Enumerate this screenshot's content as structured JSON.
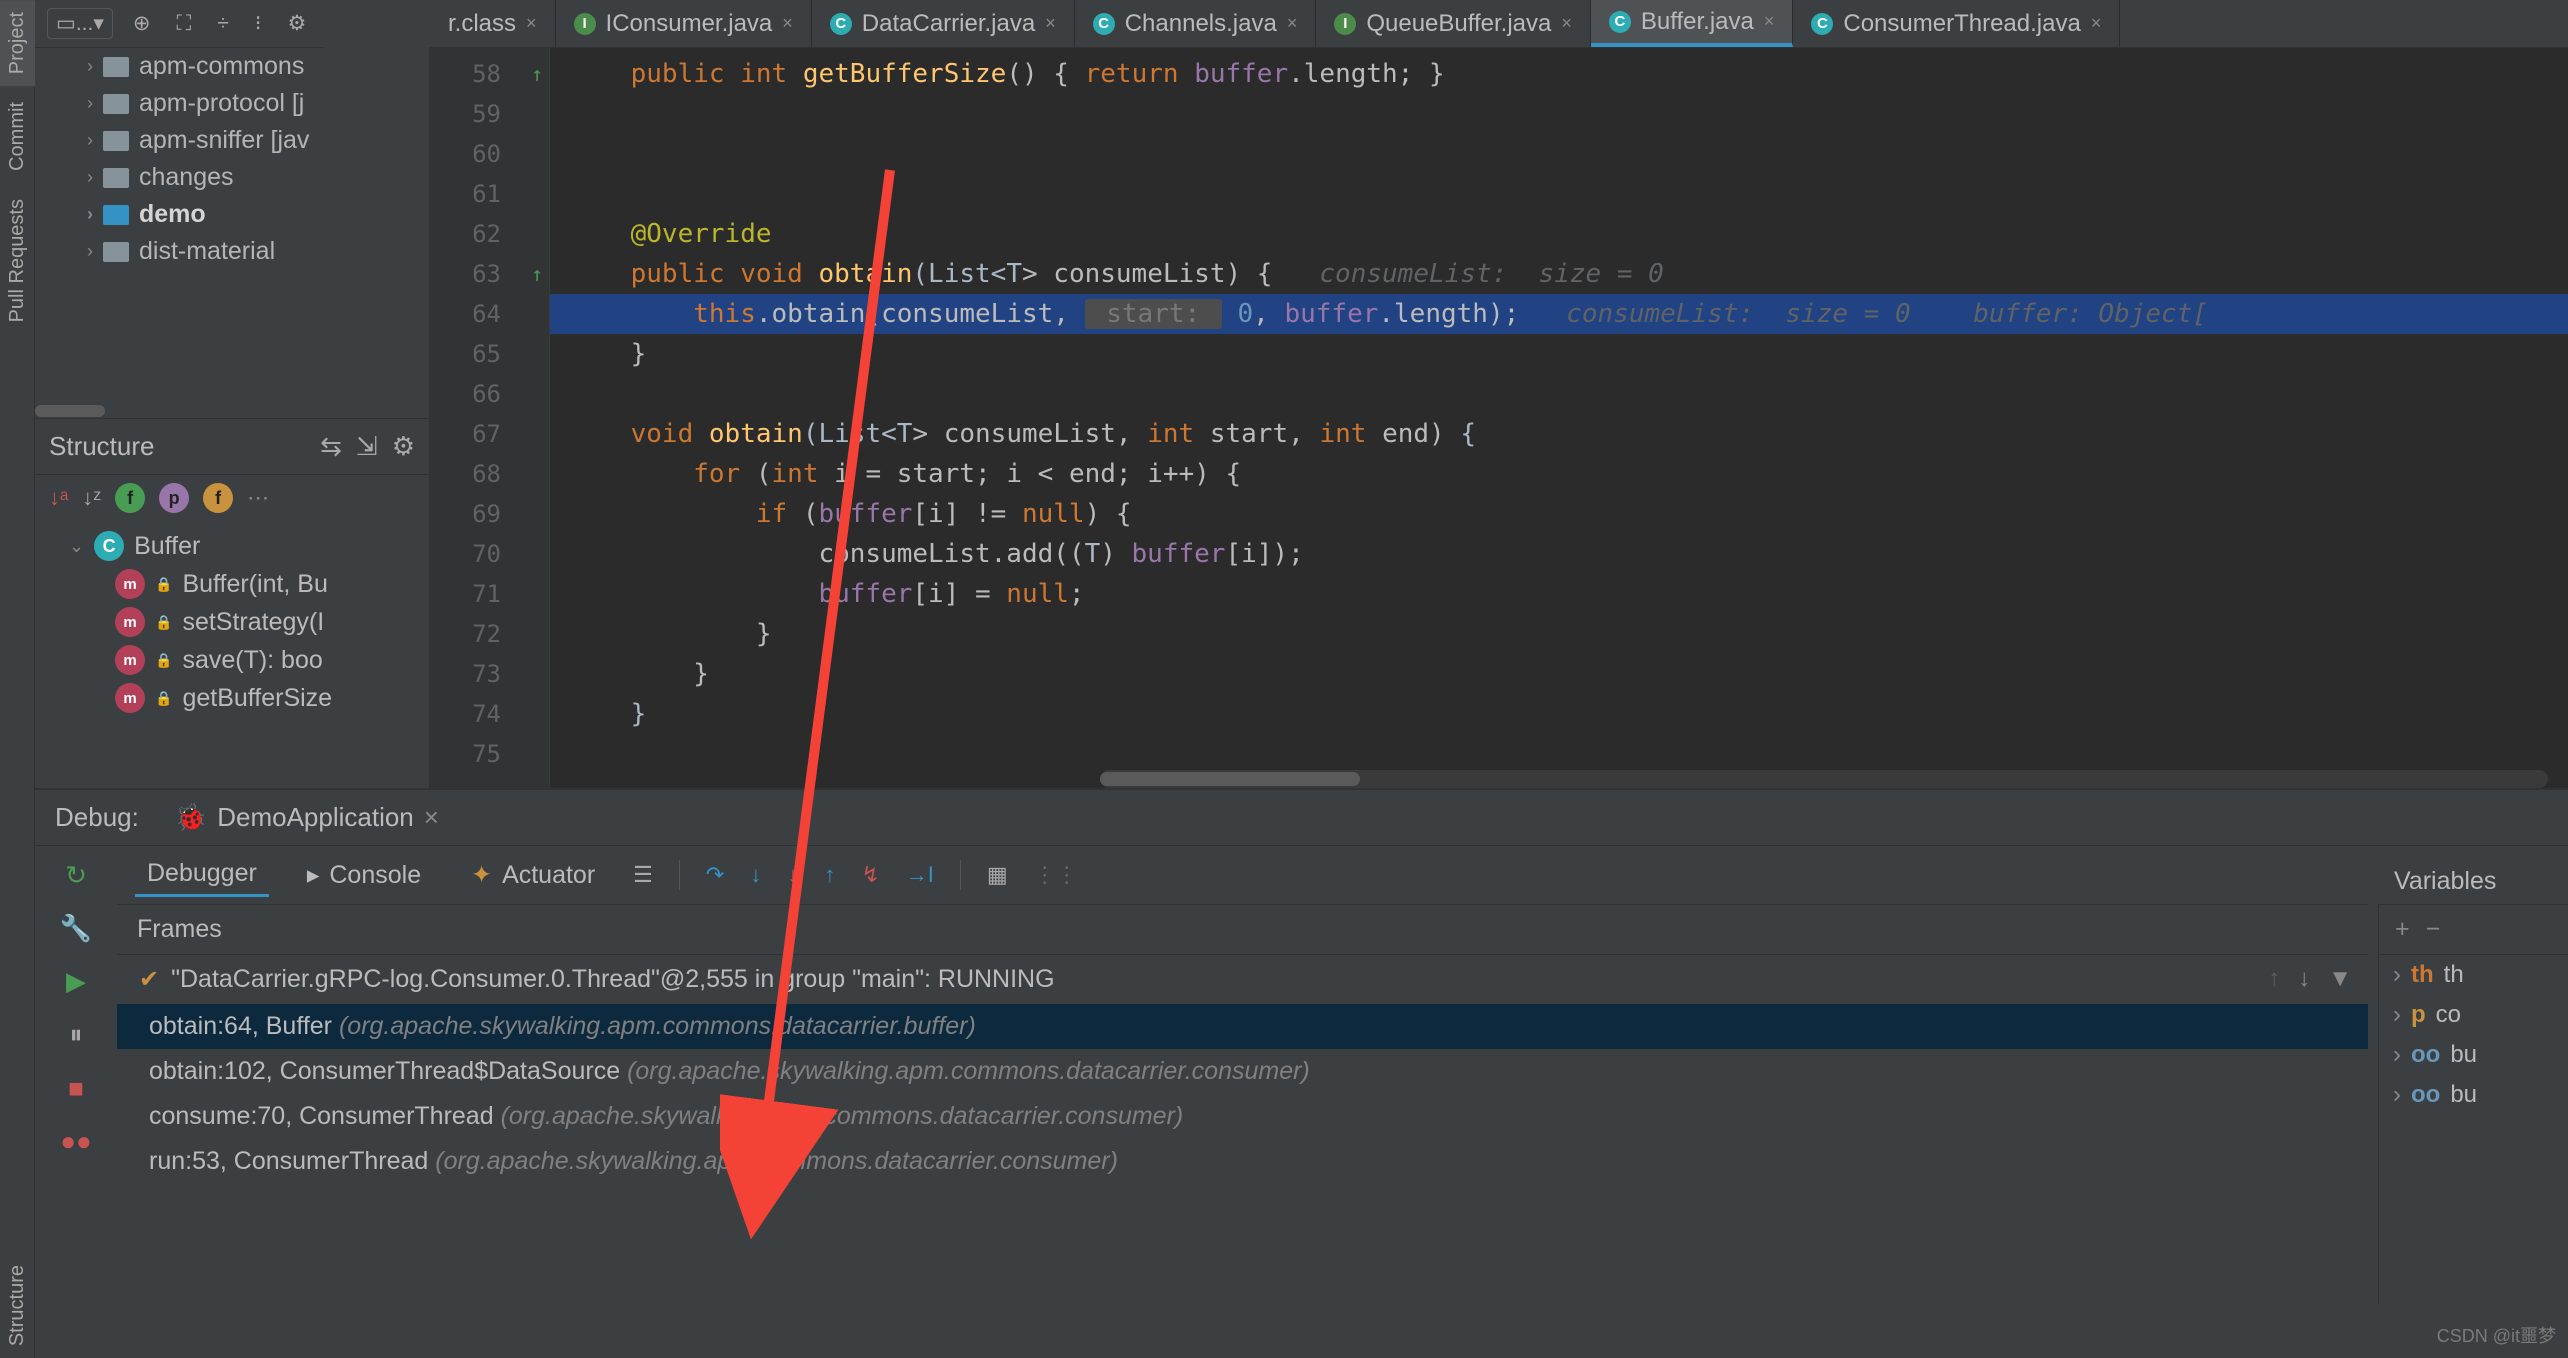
{
  "edgeTabs": {
    "project": "Project",
    "commit": "Commit",
    "pullRequests": "Pull Requests",
    "structure": "Structure"
  },
  "toolbar": {
    "dropdown": "..."
  },
  "projectTree": {
    "items": [
      {
        "label": "apm-commons",
        "bold": false
      },
      {
        "label": "apm-protocol [j",
        "bold": false
      },
      {
        "label": "apm-sniffer [jav",
        "bold": false
      },
      {
        "label": "changes",
        "bold": false
      },
      {
        "label": "demo",
        "bold": true
      },
      {
        "label": "dist-material",
        "bold": false
      }
    ]
  },
  "structurePanel": {
    "title": "Structure",
    "rootClass": "Buffer",
    "members": [
      {
        "name": "Buffer(int, Bu"
      },
      {
        "name": "setStrategy(I"
      },
      {
        "name": "save(T): boo"
      },
      {
        "name": "getBufferSize"
      }
    ]
  },
  "editorTabs": [
    {
      "label": "r.class",
      "icon": "",
      "active": false
    },
    {
      "label": "IConsumer.java",
      "icon": "i",
      "active": false
    },
    {
      "label": "DataCarrier.java",
      "icon": "c",
      "active": false
    },
    {
      "label": "Channels.java",
      "icon": "c",
      "active": false
    },
    {
      "label": "QueueBuffer.java",
      "icon": "i",
      "active": false
    },
    {
      "label": "Buffer.java",
      "icon": "c",
      "active": true
    },
    {
      "label": "ConsumerThread.java",
      "icon": "c",
      "active": false
    }
  ],
  "editor": {
    "startLine": 58,
    "lines": [
      {
        "n": 58,
        "mark": "greenup",
        "parts": [
          [
            "    ",
            ""
          ],
          [
            "public ",
            "kw"
          ],
          [
            "int ",
            "kw"
          ],
          [
            "getBufferSize",
            "mtd"
          ],
          [
            "() { ",
            ""
          ],
          [
            "return ",
            "kw"
          ],
          [
            "buffer",
            "fld"
          ],
          [
            ".length; }",
            ""
          ]
        ]
      },
      {
        "n": 59,
        "parts": []
      },
      {
        "n": 60,
        "parts": []
      },
      {
        "n": 61,
        "parts": []
      },
      {
        "n": 62,
        "parts": [
          [
            "    ",
            ""
          ],
          [
            "@Override",
            "ann"
          ]
        ]
      },
      {
        "n": 63,
        "mark": "greenup",
        "parts": [
          [
            "    ",
            ""
          ],
          [
            "public ",
            "kw"
          ],
          [
            "void ",
            "kw"
          ],
          [
            "obtain",
            "mtd"
          ],
          [
            "(List<",
            "typ"
          ],
          [
            "T",
            "typ"
          ],
          [
            "> consumeList) {   ",
            ""
          ],
          [
            "consumeList:  size = 0",
            "hint"
          ]
        ]
      },
      {
        "n": 64,
        "mark": "bp",
        "hl": true,
        "parts": [
          [
            "        ",
            ""
          ],
          [
            "this",
            "kw"
          ],
          [
            ".obtain(consumeList, ",
            ""
          ],
          [
            " start: ",
            "hlp"
          ],
          [
            " 0",
            "num"
          ],
          [
            ", ",
            ""
          ],
          [
            "buffer",
            "fld"
          ],
          [
            ".length);   ",
            ""
          ],
          [
            "consumeList:  size = 0    buffer: Object[",
            "hint"
          ]
        ]
      },
      {
        "n": 65,
        "parts": [
          [
            "    }",
            ""
          ]
        ]
      },
      {
        "n": 66,
        "parts": []
      },
      {
        "n": 67,
        "parts": [
          [
            "    ",
            ""
          ],
          [
            "void ",
            "kw"
          ],
          [
            "obtain",
            "mtd"
          ],
          [
            "(List<",
            "typ"
          ],
          [
            "T",
            "typ"
          ],
          [
            "> consumeList, ",
            ""
          ],
          [
            "int ",
            "kw"
          ],
          [
            "start",
            ""
          ],
          [
            ", ",
            ""
          ],
          [
            "int ",
            "kw"
          ],
          [
            "end",
            ""
          ],
          [
            ") ",
            ""
          ],
          [
            "{",
            "opn"
          ]
        ]
      },
      {
        "n": 68,
        "parts": [
          [
            "        ",
            ""
          ],
          [
            "for ",
            "kw"
          ],
          [
            "(",
            ""
          ],
          [
            "int ",
            "kw"
          ],
          [
            "i = start; i < end; i++) {",
            ""
          ]
        ]
      },
      {
        "n": 69,
        "parts": [
          [
            "            ",
            ""
          ],
          [
            "if ",
            "kw"
          ],
          [
            "(",
            ""
          ],
          [
            "buffer",
            "fld"
          ],
          [
            "[i] != ",
            ""
          ],
          [
            "null",
            "kw"
          ],
          [
            ") {",
            ""
          ]
        ]
      },
      {
        "n": 70,
        "parts": [
          [
            "                consumeList.add((",
            ""
          ],
          [
            "T",
            "typ"
          ],
          [
            ") ",
            ""
          ],
          [
            "buffer",
            "fld"
          ],
          [
            "[i]);",
            ""
          ]
        ]
      },
      {
        "n": 71,
        "parts": [
          [
            "                ",
            ""
          ],
          [
            "buffer",
            "fld"
          ],
          [
            "[i] = ",
            ""
          ],
          [
            "null",
            "kw"
          ],
          [
            ";",
            ""
          ]
        ]
      },
      {
        "n": 72,
        "parts": [
          [
            "            }",
            ""
          ]
        ]
      },
      {
        "n": 73,
        "parts": [
          [
            "        }",
            ""
          ]
        ]
      },
      {
        "n": 74,
        "parts": [
          [
            "    ",
            ""
          ],
          [
            "}",
            "opn"
          ]
        ]
      },
      {
        "n": 75,
        "parts": []
      }
    ]
  },
  "debug": {
    "title": "Debug:",
    "config": "DemoApplication",
    "subtabs": {
      "debugger": "Debugger",
      "console": "Console",
      "actuator": "Actuator"
    },
    "framesHeader": "Frames",
    "variablesHeader": "Variables",
    "threadLine": "\"DataCarrier.gRPC-log.Consumer.0.Thread\"@2,555 in group \"main\": RUNNING",
    "frames": [
      {
        "loc": "obtain:64, Buffer ",
        "pkg": "(org.apache.skywalking.apm.commons.datacarrier.buffer)",
        "sel": true
      },
      {
        "loc": "obtain:102, ConsumerThread$DataSource ",
        "pkg": "(org.apache.skywalking.apm.commons.datacarrier.consumer)",
        "sel": false
      },
      {
        "loc": "consume:70, ConsumerThread ",
        "pkg": "(org.apache.skywalking.apm.commons.datacarrier.consumer)",
        "sel": false
      },
      {
        "loc": "run:53, ConsumerThread ",
        "pkg": "(org.apache.skywalking.apm.commons.datacarrier.consumer)",
        "sel": false
      }
    ],
    "vars": [
      {
        "icon": "th",
        "label": "th",
        "color": "#cc7832"
      },
      {
        "icon": "p",
        "label": "co",
        "color": "#c9923e"
      },
      {
        "icon": "oo",
        "label": "bu",
        "color": "#6897bb"
      },
      {
        "icon": "oo",
        "label": "bu",
        "color": "#6897bb"
      }
    ]
  },
  "watermark": "CSDN @it噩梦"
}
